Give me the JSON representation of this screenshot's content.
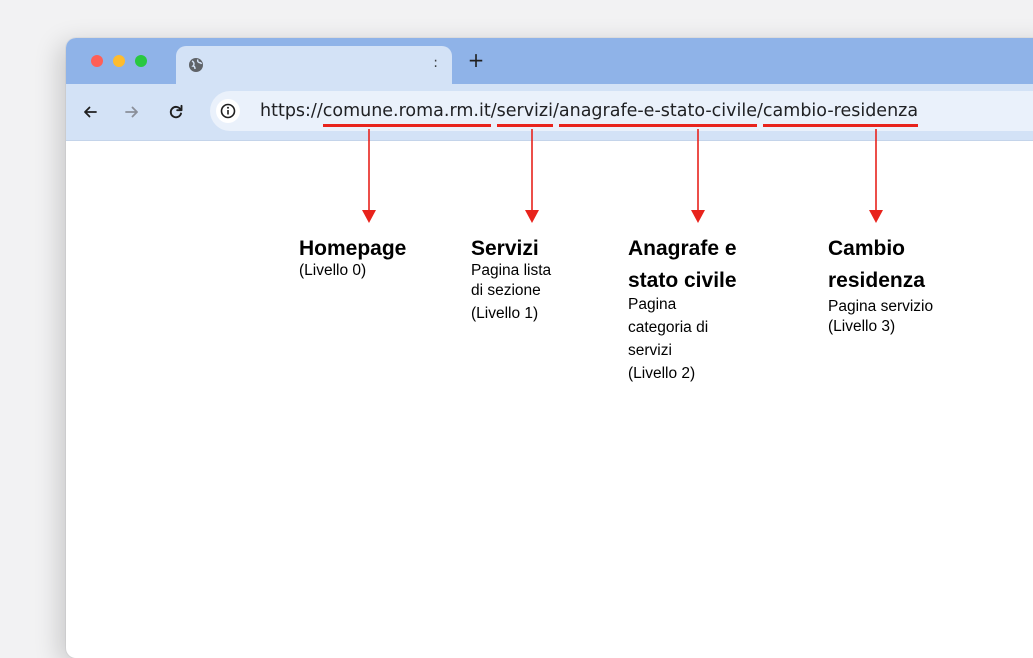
{
  "browser": {
    "tab": {
      "title": "",
      "menu_glyph": ":",
      "icon": "globe-icon"
    },
    "new_tab_label": "+",
    "nav": {
      "back_icon": "arrow-left-icon",
      "forward_icon": "arrow-right-icon",
      "reload_icon": "reload-icon",
      "info_icon": "info-icon"
    },
    "address_bar": {
      "scheme": "https://",
      "segments": [
        {
          "text": "comune.roma.rm.it"
        },
        {
          "sep": "/"
        },
        {
          "text": "servizi"
        },
        {
          "sep": "/"
        },
        {
          "text": "anagrafe-e-stato-civile"
        },
        {
          "sep": "/"
        },
        {
          "text": "cambio-residenza"
        }
      ],
      "highlight_color": "#e8231c"
    },
    "window_controls": {
      "close_color": "#ff5f57",
      "minimize_color": "#febc2e",
      "maximize_color": "#28c840"
    }
  },
  "annotations": [
    {
      "title": "Homepage",
      "lines": [
        "(Livello 0)"
      ]
    },
    {
      "title": "Servizi",
      "lines": [
        "Pagina lista",
        "di sezione",
        "(Livello 1)"
      ]
    },
    {
      "title_lines": [
        "Anagrafe e",
        "stato civile"
      ],
      "lines": [
        "Pagina",
        "categoria di",
        "servizi",
        "(Livello 2)"
      ]
    },
    {
      "title_lines": [
        "Cambio",
        "residenza"
      ],
      "lines": [
        "Pagina servizio",
        "(Livello 3)"
      ]
    }
  ],
  "arrow_color": "#e8231c"
}
